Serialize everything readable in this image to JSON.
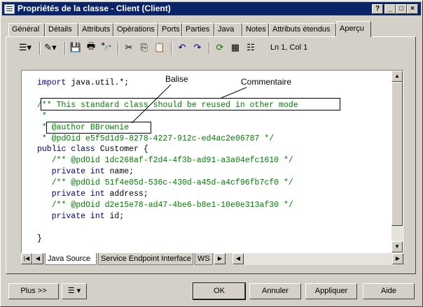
{
  "window": {
    "title": "Propriétés de la classe - Client (Client)",
    "controls": [
      "?",
      "_",
      "□",
      "×"
    ]
  },
  "tabs": [
    "Général",
    "Détails",
    "Attributs",
    "Opérations",
    "Ports",
    "Parties",
    "Java",
    "Notes",
    "Attributs étendus",
    "Aperçu"
  ],
  "active_tab": "Aperçu",
  "toolbar": {
    "position_text": "Ln 1, Col 1"
  },
  "code_lines": [
    {
      "kw": "import",
      "rest": " java.util.*;"
    },
    {
      "text": ""
    },
    {
      "cm": "/** This standard class should be reused in other mode"
    },
    {
      "cm": " *"
    },
    {
      "cm": " * @author BBrownie"
    },
    {
      "cm": " * @pdOid e5f5d1d9-8278-4227-912c-ed4ac2e06787 */"
    },
    {
      "kw": "public class",
      "rest": " Customer {"
    },
    {
      "cm": "   /** @pdOid 1dc268af-f2d4-4f3b-ad91-a3a04efc1610 */"
    },
    {
      "kw": "   private int",
      "rest": " name;"
    },
    {
      "cm": "   /** @pdOid 51f4e05d-536c-430d-a45d-a4cf96fb7cf0 */"
    },
    {
      "kw": "   private int",
      "rest": " address;"
    },
    {
      "cm": "   /** @pdOid d2e15e78-ad47-4be6-b8e1-10e0e313af30 */"
    },
    {
      "kw": "   private int",
      "rest": " id;"
    },
    {
      "text": ""
    },
    {
      "text": "}"
    }
  ],
  "annotations": {
    "balise": "Balise",
    "commentaire": "Commentaire"
  },
  "bottom_tabs": [
    "Java Source",
    "Service Endpoint Interface",
    "WS"
  ],
  "buttons": {
    "more": "Plus >>",
    "ok": "OK",
    "cancel": "Annuler",
    "apply": "Appliquer",
    "help": "Aide"
  }
}
